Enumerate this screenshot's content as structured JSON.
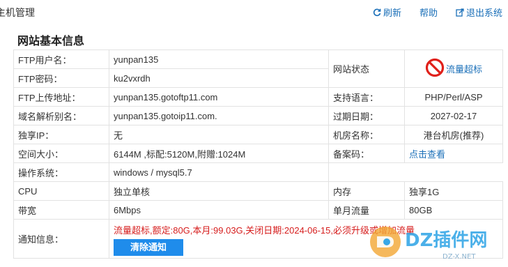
{
  "header": {
    "app_title": "主机管理",
    "refresh_label": "刷新",
    "help_label": "帮助",
    "logout_label": "退出系统"
  },
  "section": {
    "title": "网站基本信息"
  },
  "rows": {
    "ftp_user": {
      "label": "FTP用户名：",
      "value": "yunpan135"
    },
    "ftp_pass": {
      "label": "FTP密码：",
      "value": "ku2vxrdh"
    },
    "ftp_addr": {
      "label": "FTP上传地址：",
      "value": "yunpan135.gotoftp11.com"
    },
    "dns_alias": {
      "label": "域名解析别名：",
      "value": "yunpan135.gotoip11.com."
    },
    "ip": {
      "label": "独享IP：",
      "value": "无"
    },
    "space": {
      "label": "空间大小：",
      "value": "6144M ,标配:5120M,附赠:1024M"
    },
    "os": {
      "label": "操作系统：",
      "value": "windows / mysql5.7"
    },
    "cpu": {
      "label": "CPU",
      "value": "独立单核"
    },
    "bandwidth": {
      "label": "带宽",
      "value": "6Mbps"
    },
    "notice": {
      "label": "通知信息：",
      "value": "流量超标,额定:80G,本月:99.03G,关闭日期:2024-06-15,必须升级或增加流量",
      "button": "清除通知"
    }
  },
  "right": {
    "site_status": {
      "label": "网站状态",
      "value": "流量超标"
    },
    "language": {
      "label": "支持语言：",
      "value": "PHP/Perl/ASP"
    },
    "expire": {
      "label": "过期日期：",
      "value": "2027-02-17"
    },
    "room": {
      "label": "机房名称：",
      "value": "港台机房(推荐)"
    },
    "icp": {
      "label": "备案码：",
      "value": "点击查看"
    },
    "memory": {
      "label": "内存",
      "value": "独享1G"
    },
    "monthly": {
      "label": "单月流量",
      "value": "80GB"
    }
  },
  "watermark": {
    "brand": "DZ插件网",
    "url": "DZ-X.NET"
  },
  "colors": {
    "link": "#1a6fb8",
    "alert": "#d61d1d",
    "button": "#1f8ceb"
  }
}
